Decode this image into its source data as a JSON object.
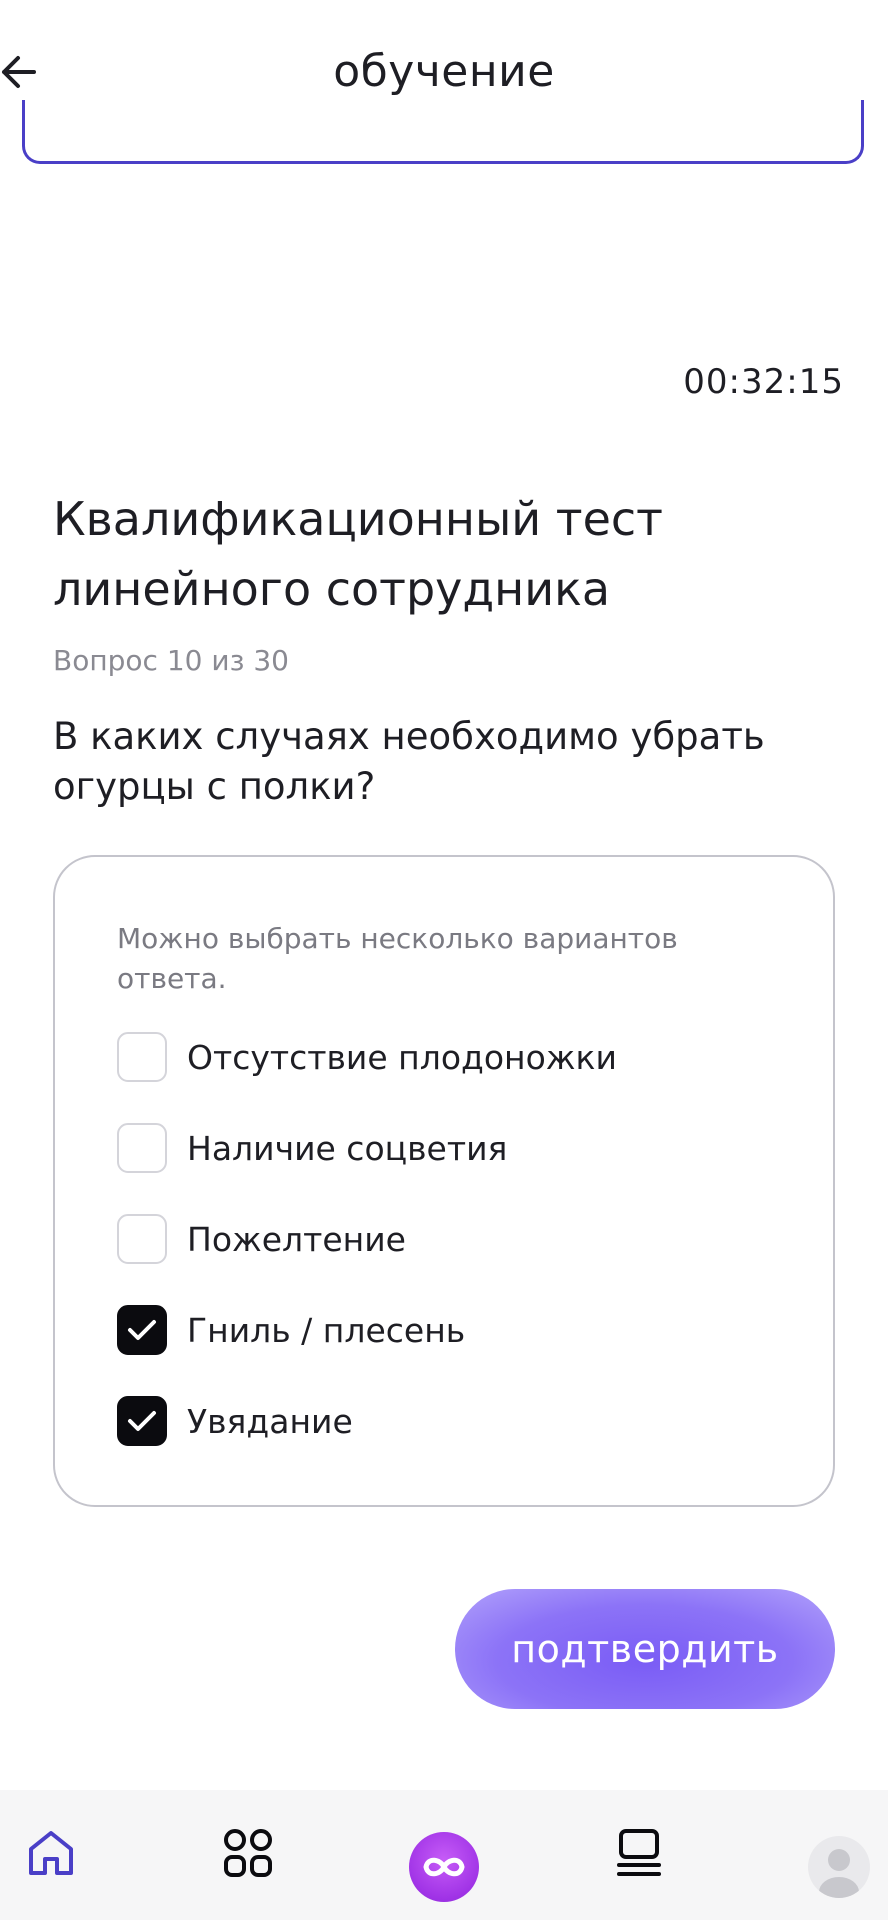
{
  "header": {
    "title": "обучение"
  },
  "timer": "00:32:15",
  "test": {
    "title": "Квалификационный тест линейного сотрудника",
    "counter": "Вопрос 10 из 30",
    "question": "В каких случаях необходимо убрать огурцы с полки?",
    "hint": "Можно выбрать несколько вариантов ответа.",
    "options": [
      {
        "label": "Отсутствие плодоножки",
        "checked": false
      },
      {
        "label": "Наличие соцветия",
        "checked": false
      },
      {
        "label": "Пожелтение",
        "checked": false
      },
      {
        "label": "Гниль / плесень",
        "checked": true
      },
      {
        "label": "Увядание",
        "checked": true
      }
    ],
    "confirm_label": "подтвердить"
  },
  "nav": {
    "items": [
      {
        "name": "home-icon",
        "active": true
      },
      {
        "name": "grid-icon",
        "active": false
      },
      {
        "name": "infinity-icon",
        "active": false
      },
      {
        "name": "catalog-icon",
        "active": false
      },
      {
        "name": "avatar-icon",
        "active": false
      }
    ]
  },
  "colors": {
    "accent": "#4a3fc7",
    "button": "#7a5cf5",
    "center_nav": "#a033e6",
    "checked": "#0b0b0f"
  }
}
